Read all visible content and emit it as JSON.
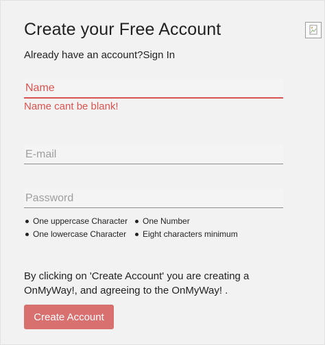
{
  "header": {
    "title": "Create your Free Account",
    "have_account_text": "Already have an account?",
    "signin_label": "Sign In"
  },
  "form": {
    "name": {
      "placeholder": "Name",
      "value": "",
      "error": "Name cant be blank!"
    },
    "email": {
      "placeholder": "E-mail",
      "value": ""
    },
    "password": {
      "placeholder": "Password",
      "value": ""
    }
  },
  "password_rules": [
    "One uppercase Character",
    "One Number",
    "One lowercase Character",
    "Eight characters minimum"
  ],
  "terms_text": "By clicking on 'Create Account' you are creating a OnMyWay!, and agreeing to the OnMyWay! .",
  "submit_label": "Create Account",
  "broken_image_icon": "broken-image-icon",
  "colors": {
    "accent": "#d97070",
    "error": "#d9534f",
    "background": "#f2f2f2"
  }
}
